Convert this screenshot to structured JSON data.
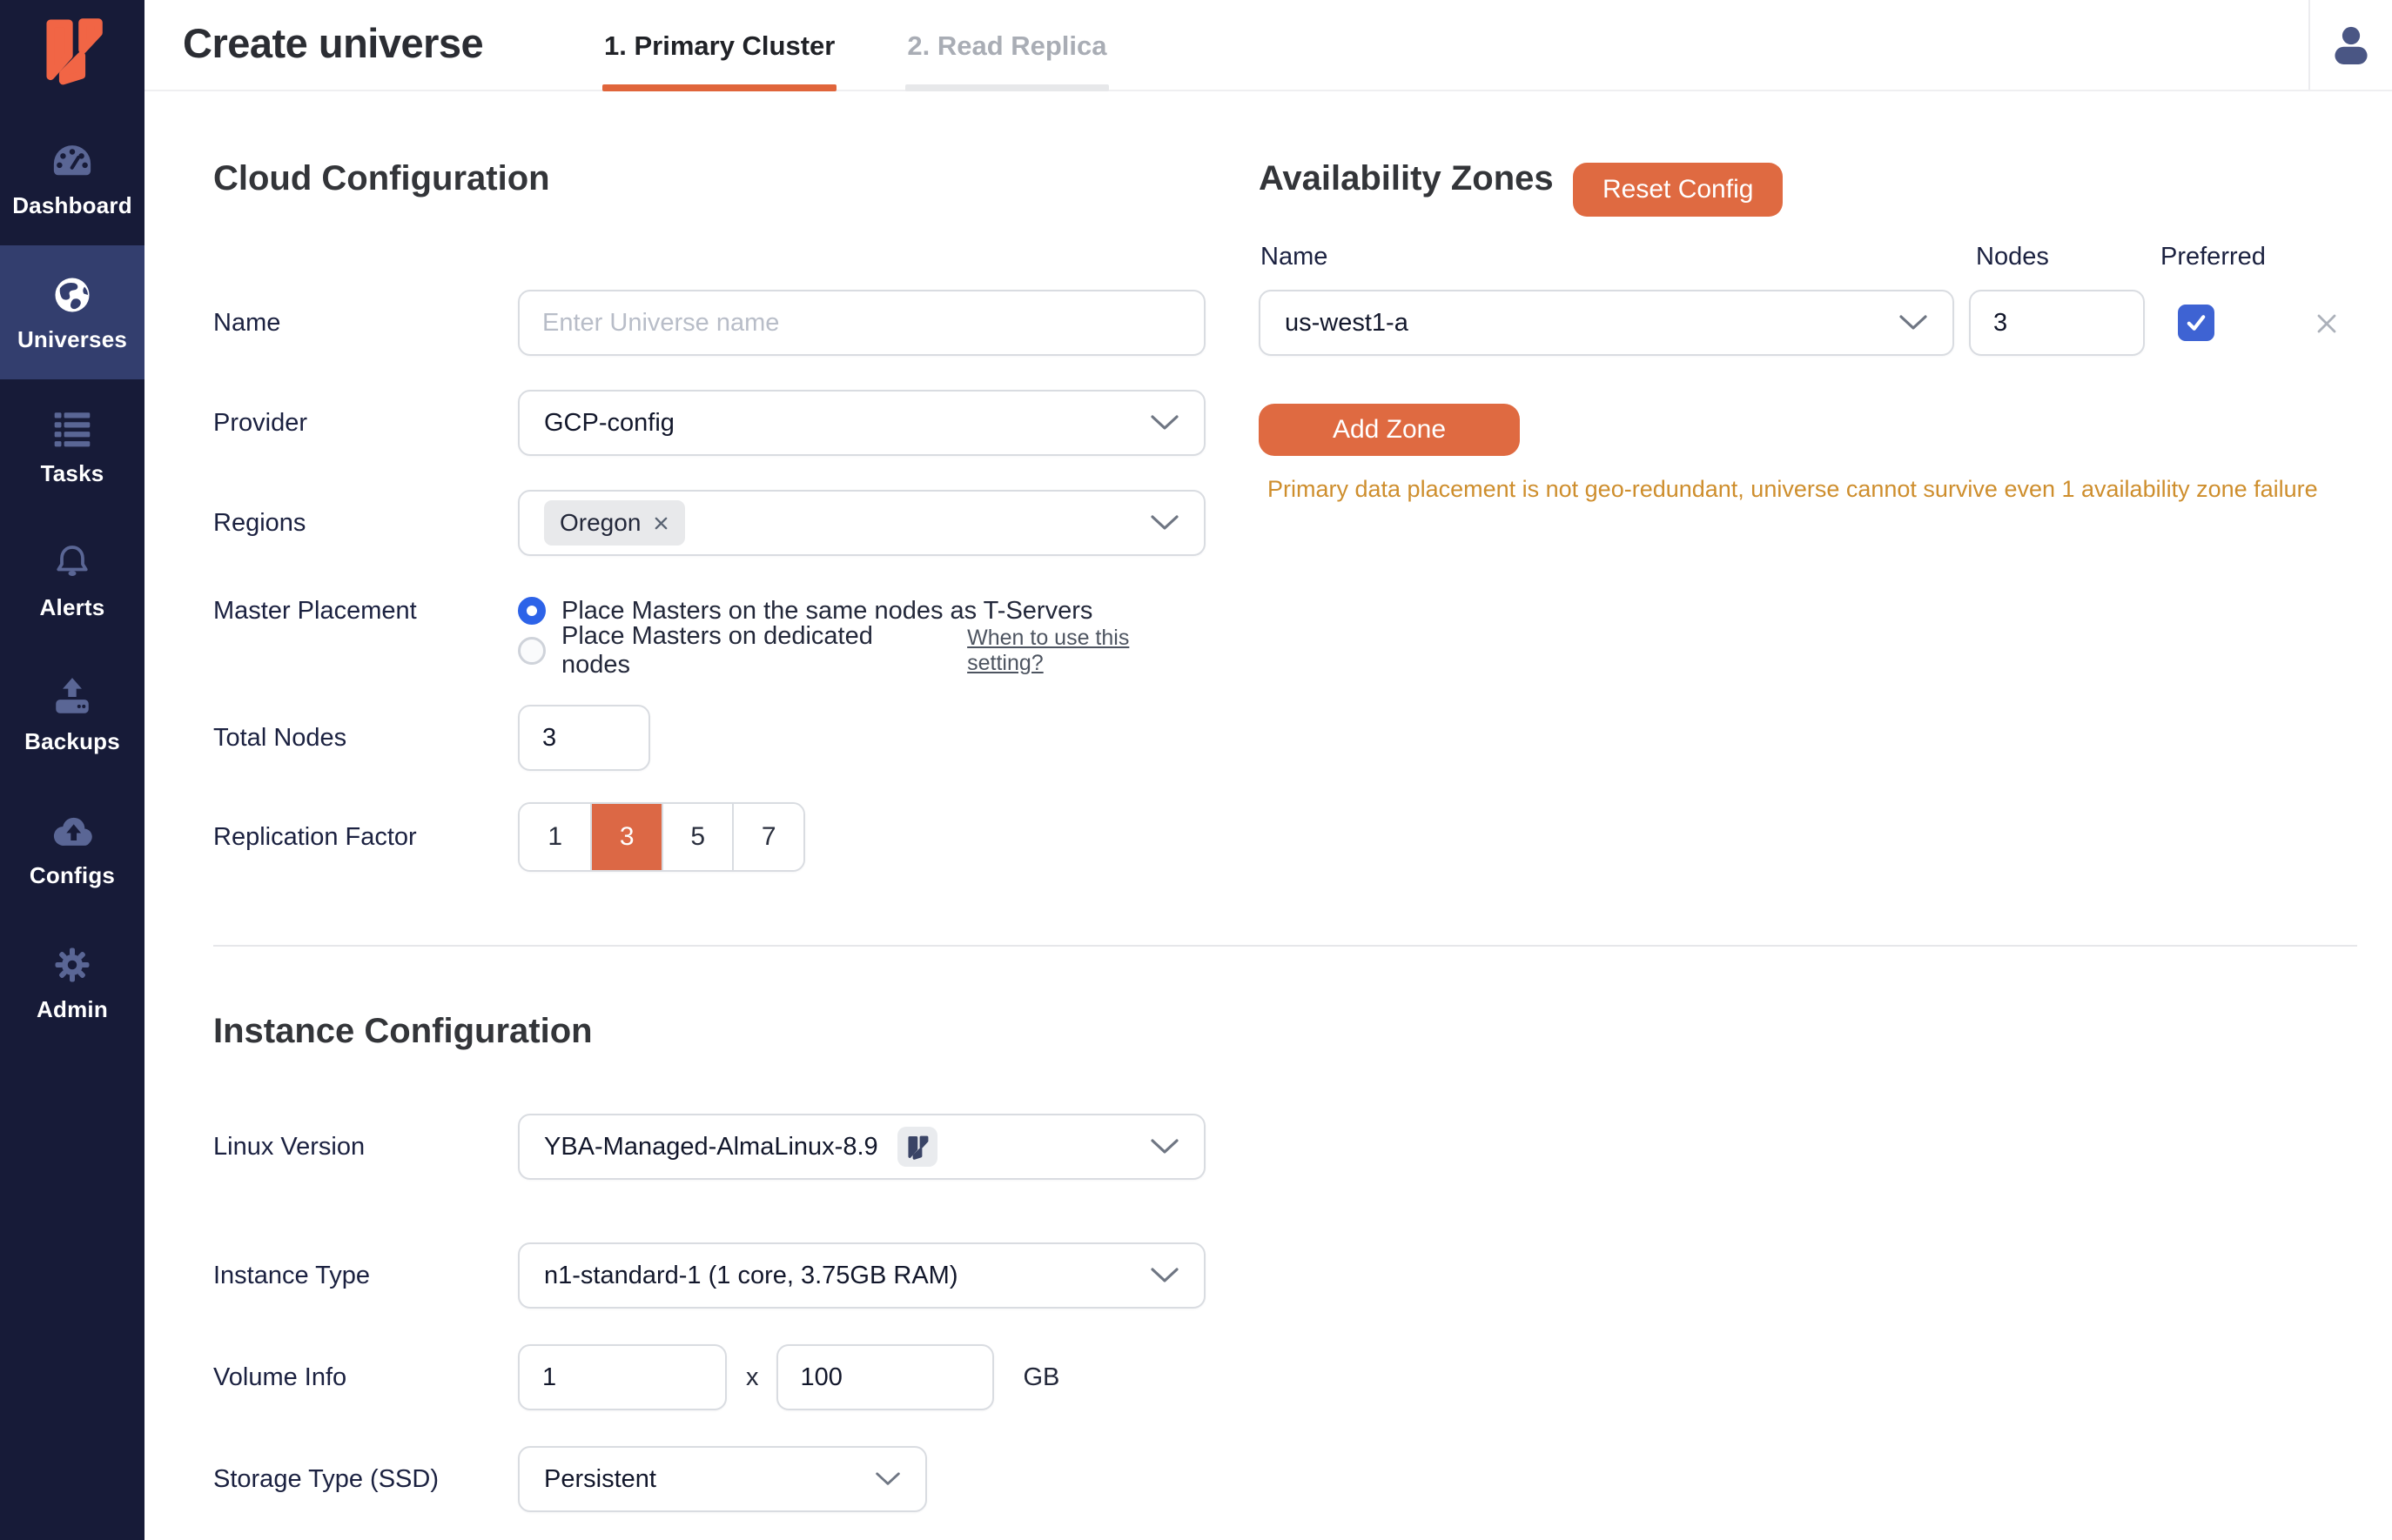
{
  "header": {
    "title": "Create universe",
    "tabs": [
      {
        "label": "1. Primary Cluster",
        "active": true
      },
      {
        "label": "2. Read Replica",
        "active": false
      }
    ]
  },
  "sidebar": {
    "items": [
      {
        "label": "Dashboard",
        "icon": "gauge-icon",
        "active": false
      },
      {
        "label": "Universes",
        "icon": "globe-icon",
        "active": true
      },
      {
        "label": "Tasks",
        "icon": "task-list-icon",
        "active": false
      },
      {
        "label": "Alerts",
        "icon": "bell-icon",
        "active": false
      },
      {
        "label": "Backups",
        "icon": "backup-drive-icon",
        "active": false
      },
      {
        "label": "Configs",
        "icon": "cloud-upload-icon",
        "active": false
      },
      {
        "label": "Admin",
        "icon": "gear-icon",
        "active": false
      }
    ]
  },
  "cloud_config": {
    "heading": "Cloud Configuration",
    "name": {
      "label": "Name",
      "value": "",
      "placeholder": "Enter Universe name"
    },
    "provider": {
      "label": "Provider",
      "value": "GCP-config"
    },
    "regions": {
      "label": "Regions",
      "chips": [
        "Oregon"
      ]
    },
    "master_placement": {
      "label": "Master Placement",
      "options": [
        {
          "label": "Place Masters on the same nodes as T-Servers",
          "selected": true
        },
        {
          "label": "Place Masters on dedicated nodes",
          "selected": false
        }
      ],
      "link": "When to use this setting?"
    },
    "total_nodes": {
      "label": "Total Nodes",
      "value": "3"
    },
    "replication_factor": {
      "label": "Replication Factor",
      "options": [
        "1",
        "3",
        "5",
        "7"
      ],
      "selected": "3"
    }
  },
  "availability_zones": {
    "heading": "Availability Zones",
    "reset_button": "Reset Config",
    "columns": {
      "name": "Name",
      "nodes": "Nodes",
      "preferred": "Preferred"
    },
    "zones": [
      {
        "name": "us-west1-a",
        "nodes": "3",
        "preferred": true
      }
    ],
    "add_zone_button": "Add Zone",
    "warning": "Primary data placement is not geo-redundant, universe cannot survive even 1 availability zone failure"
  },
  "instance_config": {
    "heading": "Instance Configuration",
    "linux_version": {
      "label": "Linux Version",
      "value": "YBA-Managed-AlmaLinux-8.9"
    },
    "instance_type": {
      "label": "Instance Type",
      "value": "n1-standard-1 (1 core, 3.75GB RAM)"
    },
    "volume_info": {
      "label": "Volume Info",
      "count": "1",
      "multiplier": "x",
      "size": "100",
      "unit": "GB"
    },
    "storage_type": {
      "label": "Storage Type (SSD)",
      "value": "Persistent"
    }
  },
  "colors": {
    "accent_orange": "#DF6A41",
    "tab_underline_orange": "#E0653B",
    "replication_selected_orange": "#DC6845",
    "logo_orange": "#F16545",
    "sidebar_bg": "#171B38",
    "sidebar_active_bg": "#333E6E",
    "sidebar_icon": "#5A6695",
    "radio_blue": "#2D63E8",
    "checkbox_blue": "#3E63D3",
    "warning_amber": "#CE8E2D"
  }
}
